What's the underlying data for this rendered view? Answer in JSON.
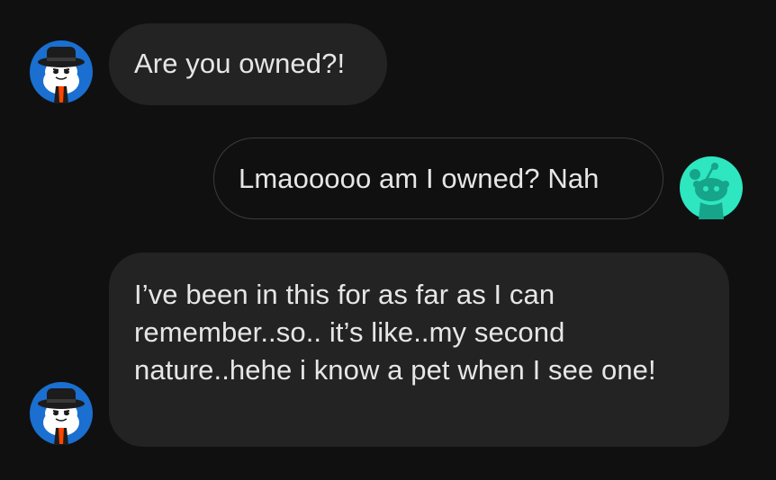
{
  "colors": {
    "background": "#101010",
    "incoming_bubble": "#232323",
    "outgoing_border": "#3c3c3c",
    "text": "#e6e6e6",
    "other_avatar_bg": "#1a6fd0",
    "self_avatar_bg": "#2ee6c0",
    "self_avatar_face": "#16a48a"
  },
  "messages": [
    {
      "sender": "other",
      "avatar_icon": "snoo-hat-avatar-icon",
      "text": "Are you owned?!"
    },
    {
      "sender": "self",
      "avatar_icon": "snoo-default-avatar-icon",
      "text": "Lmaooooo am I owned? Nah"
    },
    {
      "sender": "other",
      "avatar_icon": "snoo-hat-avatar-icon",
      "text": "I’ve been in this for as far as I can remember..so.. it’s like..my second nature..hehe i know a pet when I see one!"
    }
  ]
}
